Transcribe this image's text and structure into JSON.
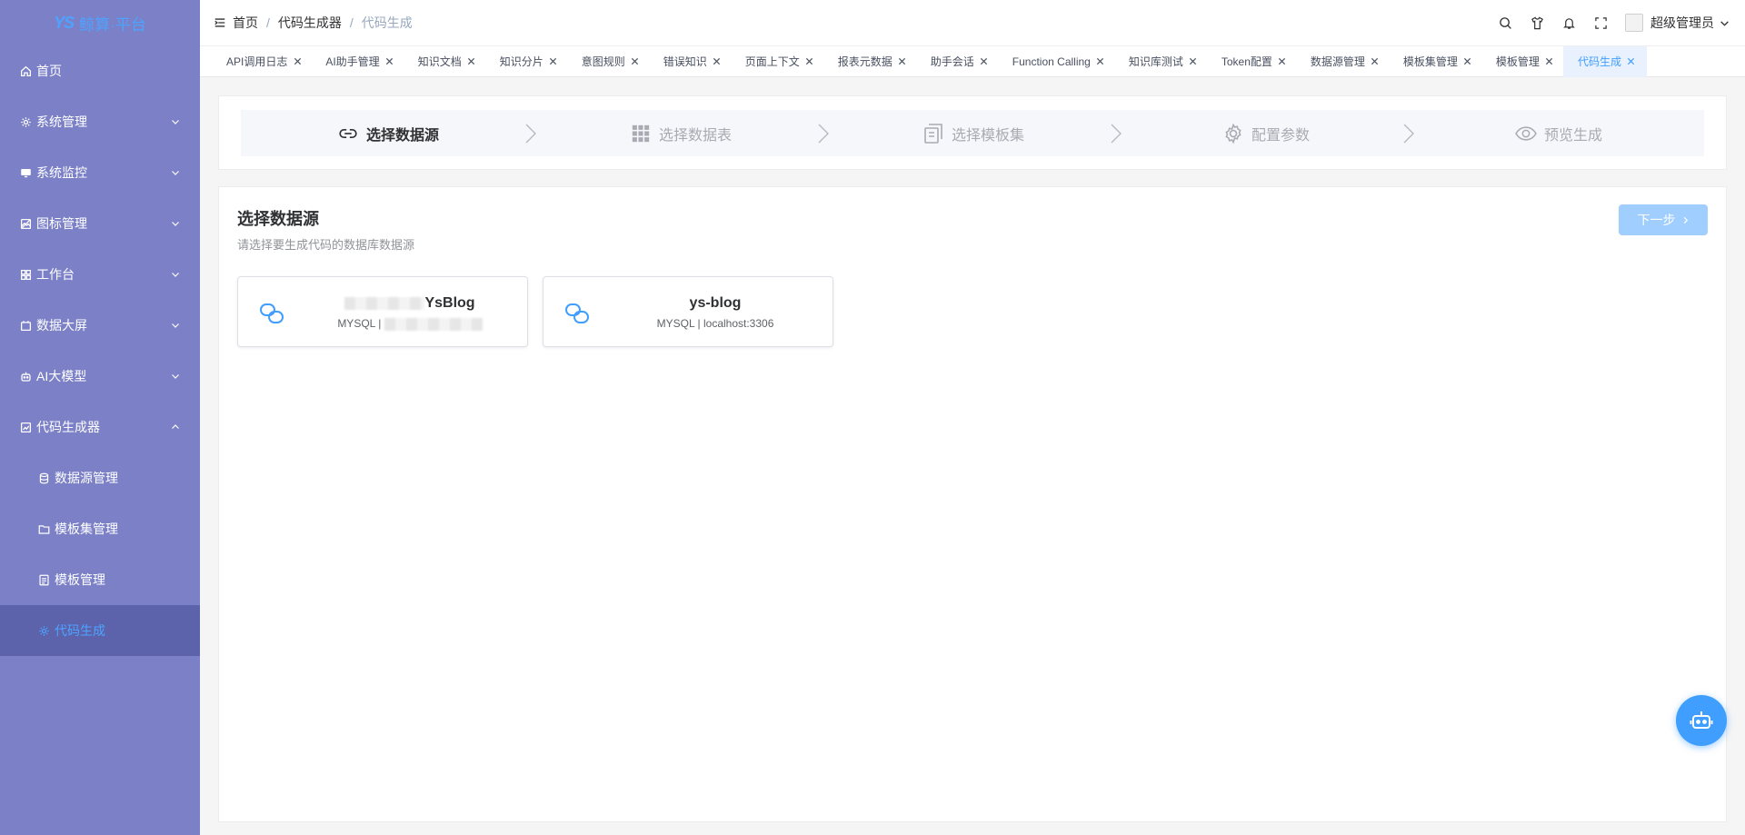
{
  "app": {
    "logo_mark": "YS",
    "logo_text": "鲸算·平台"
  },
  "sidebar": {
    "items": [
      {
        "label": "首页",
        "icon": "home-icon"
      },
      {
        "label": "系统管理",
        "icon": "gear-icon",
        "expandable": true
      },
      {
        "label": "系统监控",
        "icon": "monitor-icon",
        "expandable": true
      },
      {
        "label": "图标管理",
        "icon": "picture-icon",
        "expandable": true
      },
      {
        "label": "工作台",
        "icon": "grid-icon",
        "expandable": true
      },
      {
        "label": "数据大屏",
        "icon": "calendar-icon",
        "expandable": true
      },
      {
        "label": "AI大模型",
        "icon": "robot-icon",
        "expandable": true
      },
      {
        "label": "代码生成器",
        "icon": "chart-icon",
        "expandable": true,
        "expanded": true
      }
    ],
    "sub_items": [
      {
        "label": "数据源管理",
        "icon": "database-icon"
      },
      {
        "label": "模板集管理",
        "icon": "folder-icon"
      },
      {
        "label": "模板管理",
        "icon": "document-icon"
      },
      {
        "label": "代码生成",
        "icon": "settings-icon",
        "active": true
      }
    ]
  },
  "header": {
    "breadcrumb": [
      "首页",
      "代码生成器",
      "代码生成"
    ],
    "username": "超级管理员"
  },
  "tabs": [
    {
      "label": "API调用日志"
    },
    {
      "label": "AI助手管理"
    },
    {
      "label": "知识文档"
    },
    {
      "label": "知识分片"
    },
    {
      "label": "意图规则"
    },
    {
      "label": "错误知识"
    },
    {
      "label": "页面上下文"
    },
    {
      "label": "报表元数据"
    },
    {
      "label": "助手会话"
    },
    {
      "label": "Function Calling"
    },
    {
      "label": "知识库测试"
    },
    {
      "label": "Token配置"
    },
    {
      "label": "数据源管理"
    },
    {
      "label": "模板集管理"
    },
    {
      "label": "模板管理"
    },
    {
      "label": "代码生成",
      "active": true
    }
  ],
  "steps": [
    {
      "label": "选择数据源",
      "icon": "link-icon",
      "active": true
    },
    {
      "label": "选择数据表",
      "icon": "grid-icon"
    },
    {
      "label": "选择模板集",
      "icon": "copy-document-icon"
    },
    {
      "label": "配置参数",
      "icon": "settings-icon"
    },
    {
      "label": "预览生成",
      "icon": "eye-icon"
    }
  ],
  "section": {
    "title": "选择数据源",
    "description": "请选择要生成代码的数据库数据源",
    "next_label": "下一步"
  },
  "datasources": [
    {
      "name": "YsBlog",
      "type": "MYSQL |"
    },
    {
      "name": "ys-blog",
      "type": "MYSQL | localhost:3306"
    }
  ],
  "colors": {
    "sidebar_bg": "#7b80c7",
    "sidebar_active_bg": "#5d63ab",
    "accent": "#409eff",
    "next_disabled": "#a0cfff"
  }
}
